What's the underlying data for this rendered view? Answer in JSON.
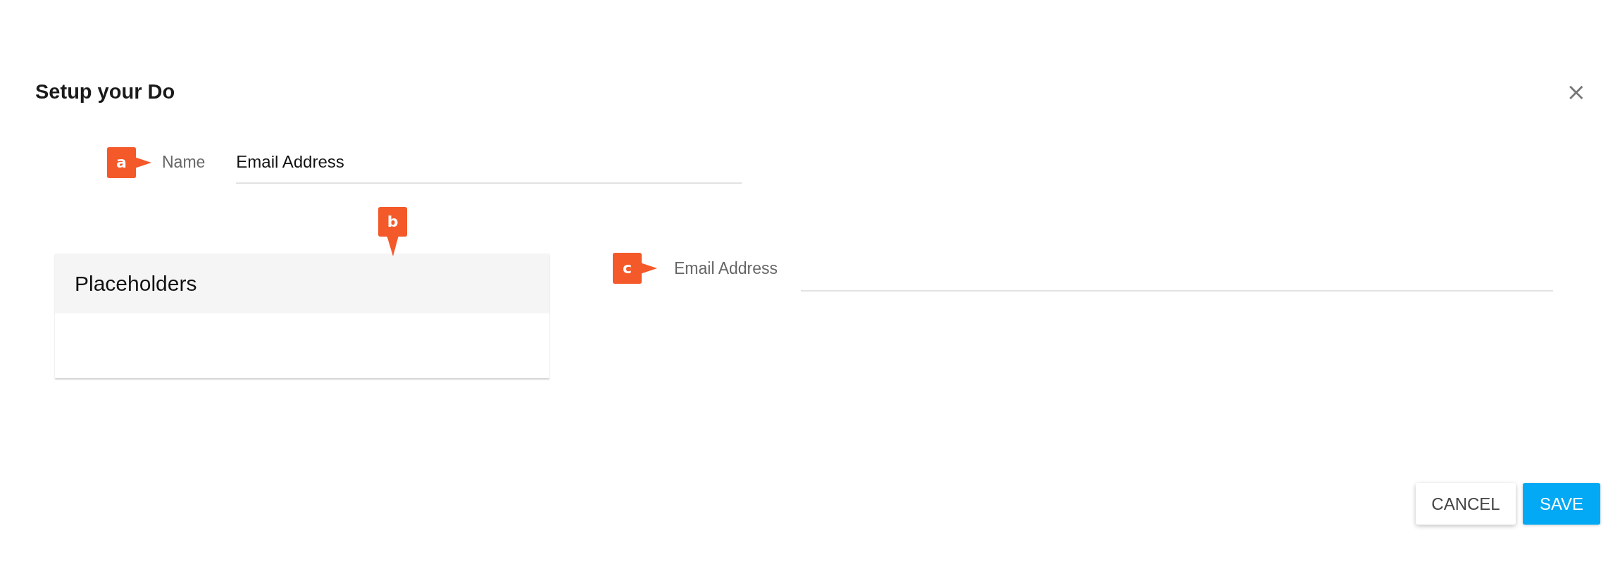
{
  "dialog": {
    "title": "Setup your Do",
    "close": "×"
  },
  "name_field": {
    "callout": "a",
    "label": "Name",
    "value": "Email Address"
  },
  "placeholders_panel": {
    "callout": "b",
    "title": "Placeholders"
  },
  "email_field": {
    "callout": "c",
    "label": "Email Address"
  },
  "buttons": [
    {
      "label": "CANCEL",
      "kind": "secondary"
    },
    {
      "label": "SAVE",
      "kind": "primary"
    }
  ]
}
